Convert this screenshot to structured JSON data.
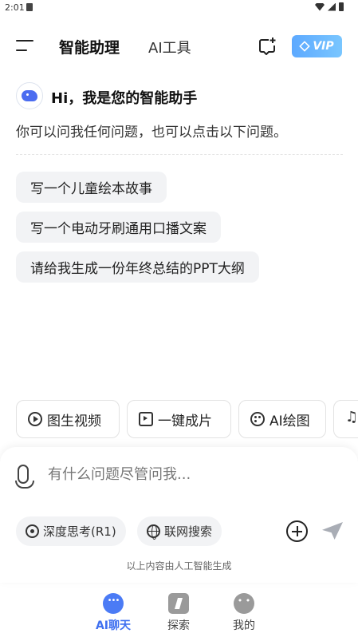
{
  "status_bar": {
    "time": "2:01"
  },
  "header": {
    "tab_active": "智能助理",
    "tab_inactive": "AI工具",
    "vip_label": "VIP"
  },
  "greeting": {
    "title": "Hi，我是您的智能助手",
    "subtitle": "你可以问我任何问题，也可以点击以下问题。"
  },
  "suggestions": [
    "写一个儿童绘本故事",
    "写一个电动牙刷通用口播文案",
    "请给我生成一份年终总结的PPT大纲"
  ],
  "tools": [
    "图生视频",
    "一键成片",
    "AI绘图"
  ],
  "input": {
    "placeholder": "有什么问题尽管问我...",
    "value": ""
  },
  "modes": {
    "deep_think": "深度思考(R1)",
    "web_search": "联网搜索"
  },
  "disclaimer": "以上内容由人工智能生成",
  "nav": {
    "chat": "AI聊天",
    "explore": "探索",
    "mine": "我的"
  },
  "colors": {
    "accent": "#3f70f0",
    "vip_gradient_start": "#5da9ff",
    "chip_bg": "#f2f3f5"
  }
}
